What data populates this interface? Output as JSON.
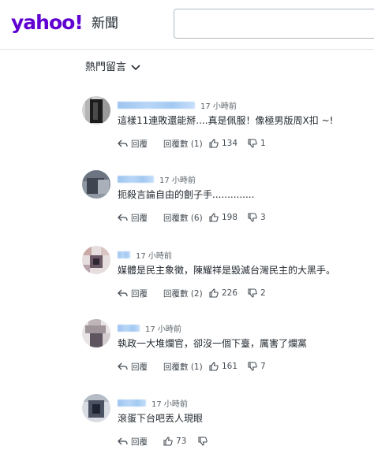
{
  "header": {
    "logo_text": "yahoo!",
    "logo_sub": "新聞",
    "brand_color": "#6001d2",
    "search": {
      "placeholder": "",
      "value": ""
    }
  },
  "sort": {
    "label": "熱門留言"
  },
  "comments": [
    {
      "time": "17 小時前",
      "text": "這樣11連敗還能掰....真是佩服！像極男版周X扣 ~!",
      "reply": "回覆",
      "replies": "回覆數 (1)",
      "likes": "134",
      "dislikes": "1"
    },
    {
      "time": "17 小時前",
      "text": "扼殺言論自由的劊子手..............",
      "reply": "回覆",
      "replies": "回覆數 (6)",
      "likes": "198",
      "dislikes": "3"
    },
    {
      "time": "17 小時前",
      "text": "媒體是民主象徵，陳耀祥是毀滅台灣民主的大黑手。",
      "reply": "回覆",
      "replies": "回覆數 (2)",
      "likes": "226",
      "dislikes": "2"
    },
    {
      "time": "17 小時前",
      "text": "執政一大堆爛官，卻沒一個下臺，厲害了爛黨",
      "reply": "回覆",
      "replies": "回覆數 (1)",
      "likes": "161",
      "dislikes": "7"
    },
    {
      "time": "17 小時前",
      "text": "滾蛋下台吧丟人現眼",
      "reply": "回覆",
      "replies": "",
      "likes": "73",
      "dislikes": ""
    }
  ]
}
